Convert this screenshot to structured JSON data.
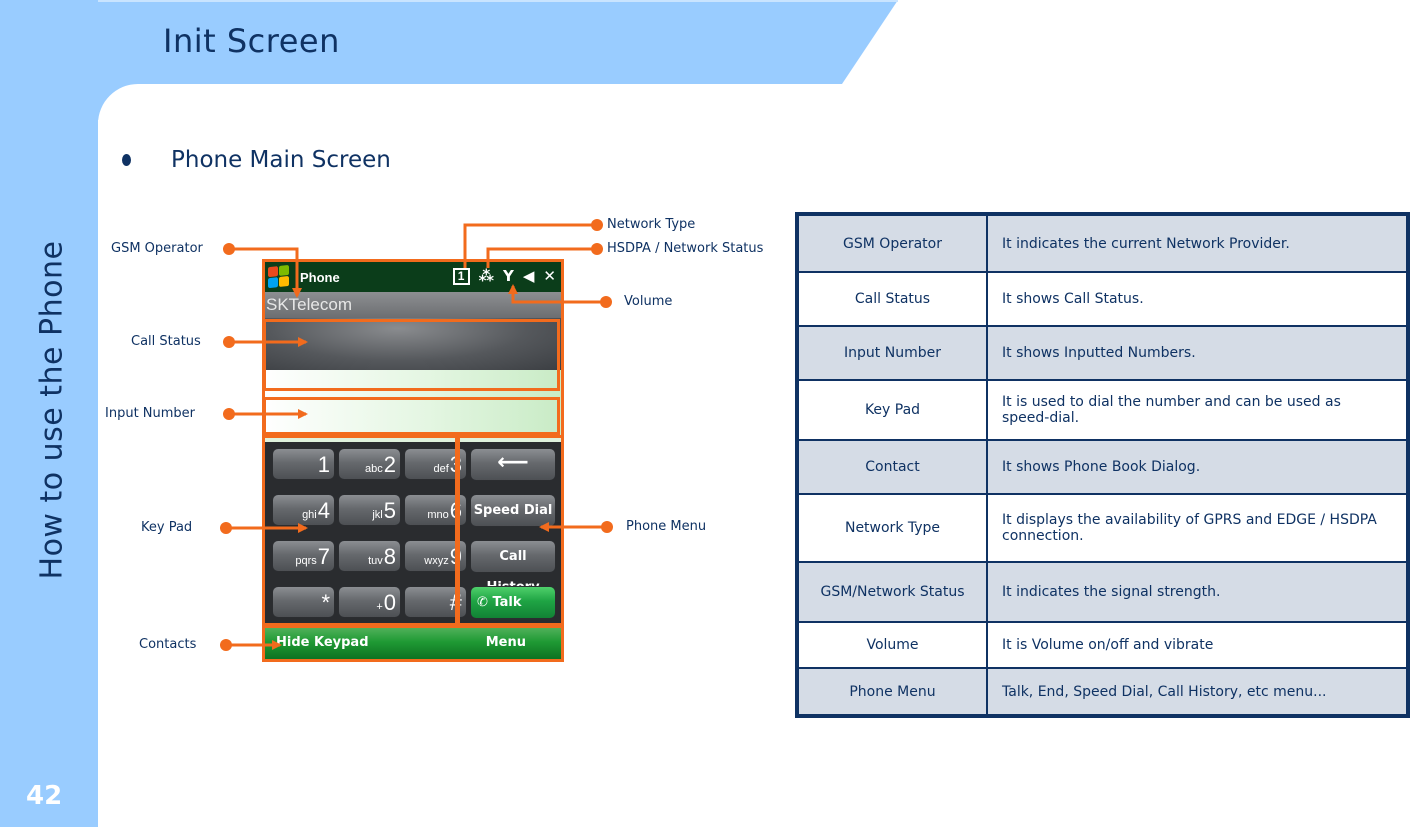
{
  "page": {
    "title": "Init Screen",
    "side_title": "How to use the Phone",
    "page_number": "42",
    "bullet": "Phone Main Screen"
  },
  "colors": {
    "band": "#99ccff",
    "text": "#0f3263",
    "callout": "#f26b1d",
    "table_border": "#0f3263",
    "table_shade": "#d5dce6"
  },
  "phone": {
    "app_title": "Phone",
    "icons": [
      "windows-logo",
      "sim-1-icon",
      "network-type-icon",
      "signal-icon",
      "volume-icon",
      "close-icon"
    ],
    "sim_label": "1",
    "network_glyph": "⁂",
    "signal_glyph": "Y",
    "volume_glyph": "◀",
    "close_glyph": "✕",
    "operator": "SKTelecom",
    "keys": [
      {
        "num": "1",
        "sub": ""
      },
      {
        "num": "2",
        "sub": "abc"
      },
      {
        "num": "3",
        "sub": "def"
      },
      {
        "num": "4",
        "sub": "ghi"
      },
      {
        "num": "5",
        "sub": "jkl"
      },
      {
        "num": "6",
        "sub": "mno"
      },
      {
        "num": "7",
        "sub": "pqrs"
      },
      {
        "num": "8",
        "sub": "tuv"
      },
      {
        "num": "9",
        "sub": "wxyz"
      },
      {
        "num": "*",
        "sub": ""
      },
      {
        "num": "0",
        "sub": "+"
      },
      {
        "num": "#",
        "sub": ""
      }
    ],
    "function_keys": {
      "backspace": "⟵",
      "speed_dial": "Speed Dial",
      "call_history": "Call History",
      "talk": "Talk",
      "talk_icon": "✆"
    },
    "softkeys": {
      "left": "Hide Keypad",
      "right": "Menu"
    }
  },
  "callouts": {
    "gsm_operator": "GSM Operator",
    "call_status": "Call Status",
    "input_number": "Input Number",
    "key_pad": "Key Pad",
    "contacts": "Contacts",
    "network_type": "Network Type",
    "hsdpa_status": "HSDPA / Network Status",
    "volume": "Volume",
    "phone_menu": "Phone Menu"
  },
  "table": {
    "rows": [
      {
        "term": "GSM Operator",
        "desc": "It indicates the current Network Provider."
      },
      {
        "term": "Call Status",
        "desc": "It shows Call Status."
      },
      {
        "term": "Input Number",
        "desc": "It shows Inputted Numbers."
      },
      {
        "term": "Key Pad",
        "desc": "It is used to dial the number and can be used as speed-dial."
      },
      {
        "term": "Contact",
        "desc": "It shows Phone Book Dialog."
      },
      {
        "term": "Network Type",
        "desc": "It displays the availability of GPRS and EDGE  / HSDPA connection."
      },
      {
        "term": "GSM/Network Status",
        "desc": "It indicates the signal strength."
      },
      {
        "term": "Volume",
        "desc": "It is Volume on/off and vibrate"
      },
      {
        "term": "Phone Menu",
        "desc": "Talk, End, Speed Dial, Call History, etc menu..."
      }
    ]
  }
}
